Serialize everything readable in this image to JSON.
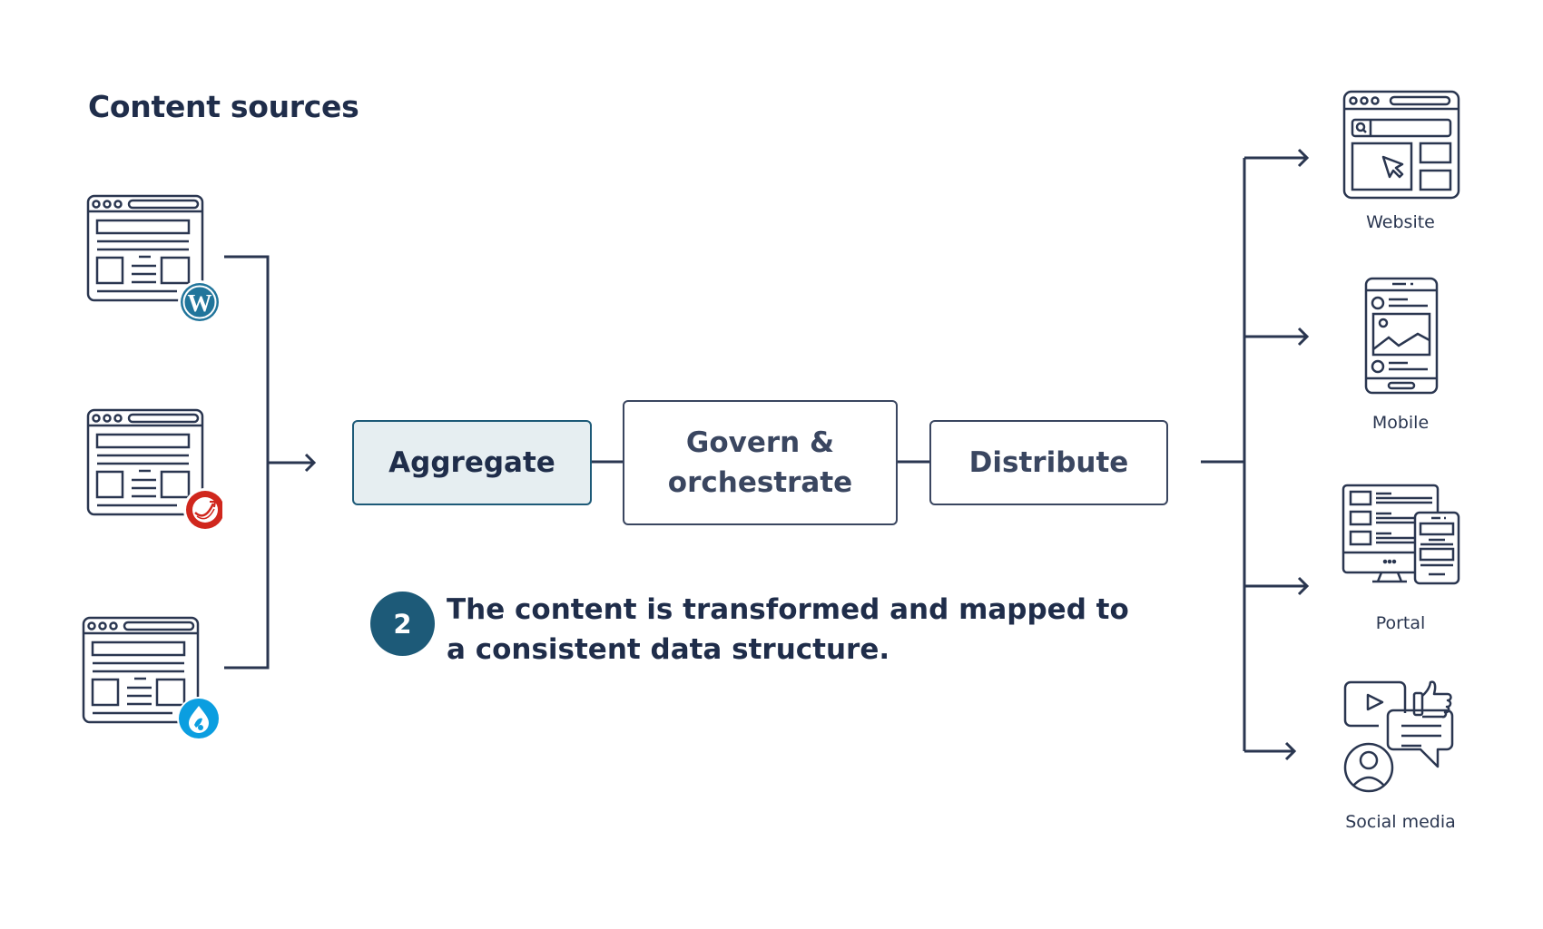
{
  "sources": {
    "title": "Content sources",
    "items": [
      {
        "name": "WordPress",
        "icon": "wordpress-icon",
        "badge_color": "#21759b"
      },
      {
        "name": "Sitecore",
        "icon": "sitecore-icon",
        "badge_color": "#d0271d"
      },
      {
        "name": "Drupal",
        "icon": "drupal-icon",
        "badge_color": "#0b9ee0"
      }
    ]
  },
  "pipeline": {
    "steps": [
      {
        "label": "Aggregate",
        "active": true
      },
      {
        "label": "Govern & orchestrate",
        "active": false
      },
      {
        "label": "Distribute",
        "active": false
      }
    ]
  },
  "callout": {
    "step_number": "2",
    "text": "The content is transformed and mapped to a consistent data structure."
  },
  "outputs": [
    {
      "label": "Website",
      "icon": "website-icon"
    },
    {
      "label": "Mobile",
      "icon": "mobile-icon"
    },
    {
      "label": "Portal",
      "icon": "portal-icon"
    },
    {
      "label": "Social media",
      "icon": "social-media-icon"
    }
  ],
  "colors": {
    "ink": "#1f2d4a",
    "stroke": "#2a3650",
    "accent": "#1d5a78",
    "active_fill": "#e6eef1"
  }
}
